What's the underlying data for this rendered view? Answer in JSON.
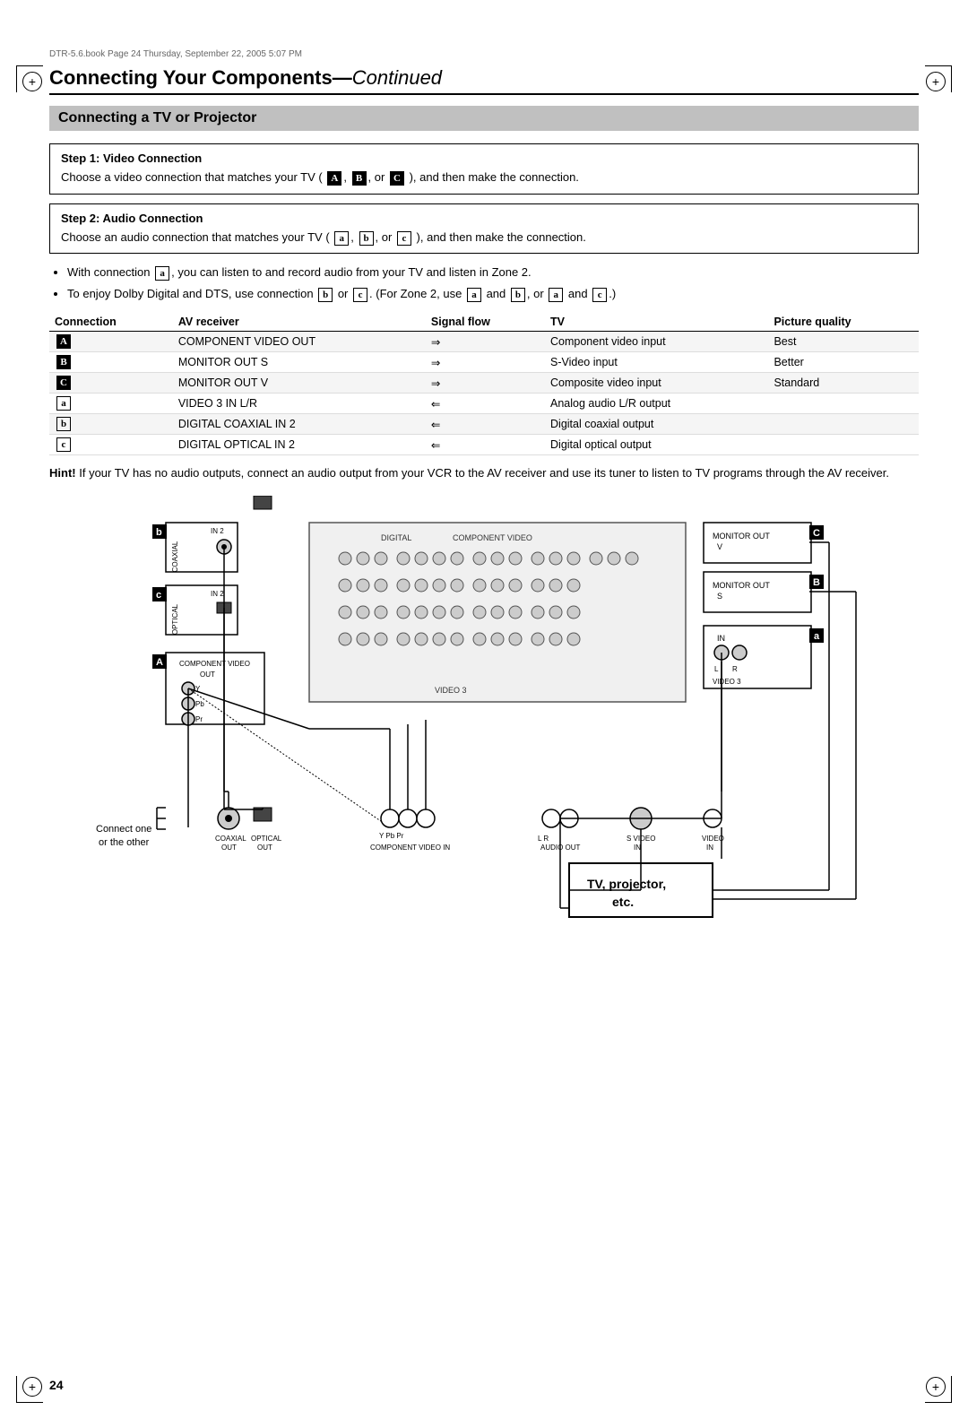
{
  "page": {
    "file_info": "DTR-5.6.book  Page 24  Thursday, September 22, 2005  5:07 PM",
    "page_number": "24",
    "main_title": "Connecting Your Components",
    "main_title_continued": "Continued",
    "section_title": "Connecting a TV or Projector",
    "step1": {
      "title": "Step 1: Video Connection",
      "text": "Choose a video connection that matches your TV (",
      "badges": [
        "A",
        "B",
        "C"
      ],
      "text2": "), and then make the connection."
    },
    "step2": {
      "title": "Step 2: Audio Connection",
      "text": "Choose an audio connection that matches your TV (",
      "badges": [
        "a",
        "b",
        "c"
      ],
      "text2": "), and then make the connection."
    },
    "bullets": [
      "With connection a, you can listen to and record audio from your TV and listen in Zone 2.",
      "To enjoy Dolby Digital and DTS, use connection b or c. (For Zone 2, use a and b, or a and c.)"
    ],
    "table": {
      "headers": [
        "Connection",
        "AV receiver",
        "Signal flow",
        "TV",
        "Picture quality"
      ],
      "rows": [
        {
          "conn": "A",
          "filled": true,
          "av": "COMPONENT VIDEO OUT",
          "flow": "⇒",
          "tv": "Component video input",
          "quality": "Best"
        },
        {
          "conn": "B",
          "filled": true,
          "av": "MONITOR OUT S",
          "flow": "⇒",
          "tv": "S-Video input",
          "quality": "Better"
        },
        {
          "conn": "C",
          "filled": true,
          "av": "MONITOR OUT V",
          "flow": "⇒",
          "tv": "Composite video input",
          "quality": "Standard"
        },
        {
          "conn": "a",
          "filled": false,
          "av": "VIDEO 3 IN L/R",
          "flow": "⇐",
          "tv": "Analog audio L/R output",
          "quality": ""
        },
        {
          "conn": "b",
          "filled": false,
          "av": "DIGITAL COAXIAL IN 2",
          "flow": "⇐",
          "tv": "Digital coaxial output",
          "quality": ""
        },
        {
          "conn": "c",
          "filled": false,
          "av": "DIGITAL OPTICAL IN 2",
          "flow": "⇐",
          "tv": "Digital optical output",
          "quality": ""
        }
      ]
    },
    "hint": {
      "title": "Hint!",
      "text": "If your TV has no audio outputs, connect an audio output from your VCR to the AV receiver and use its tuner to listen to TV programs through the AV receiver."
    },
    "diagram": {
      "labels": {
        "b_coaxial": "COAXIAL",
        "b_in2": "IN 2",
        "c_optical": "OPTICAL",
        "c_in2": "IN 2",
        "a_component_video": "COMPONENT VIDEO",
        "a_out": "OUT",
        "monitor_out_c": "MONITOR OUT",
        "c_label": "C",
        "monitor_out_b": "MONITOR OUT",
        "b_label": "B",
        "in_a": "IN",
        "a_label": "a",
        "video3": "VIDEO 3",
        "bottom_coaxial_out": "COAXIAL OUT",
        "bottom_optical_out": "OPTICAL OUT",
        "bottom_y": "Y",
        "bottom_pb": "Pb",
        "bottom_pr": "Pr",
        "bottom_component_video_in": "COMPONENT VIDEO IN",
        "bottom_audio_out": "AUDIO OUT",
        "bottom_svideo_in": "S VIDEO IN",
        "bottom_video_in": "VIDEO IN",
        "connect_one_or_other": "Connect one\nor the other",
        "tv_box": "TV, projector,\netc."
      }
    }
  }
}
